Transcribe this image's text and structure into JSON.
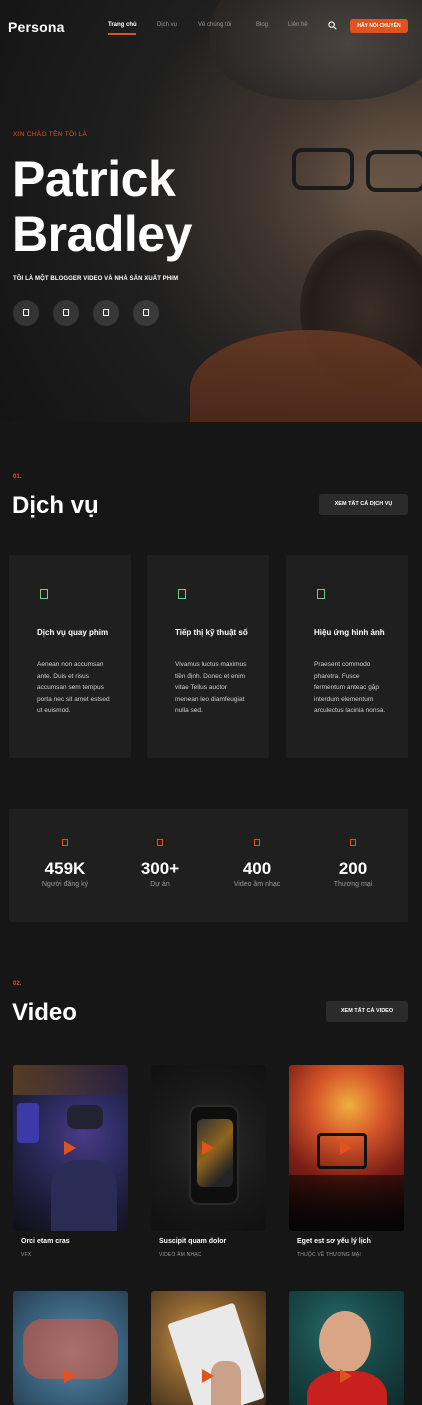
{
  "nav": {
    "logo": "Persona",
    "items": [
      "Trang chủ",
      "Dịch vụ",
      "Về chúng tôi",
      "Blog",
      "Liên hệ"
    ],
    "cta": "HÃY NÓI CHUYỆN"
  },
  "hero": {
    "eyebrow": "XIN CHÀO TÊN TÔI LÀ",
    "name_line1": "Patrick",
    "name_line2": "Bradley",
    "subtitle": "TÔI LÀ MỘT BLOGGER VIDEO VÀ NHÀ SẢN XUẤT PHIM",
    "social_icons": [
      "facebook-icon",
      "twitter-icon",
      "instagram-icon",
      "youtube-icon"
    ]
  },
  "services": {
    "number": "01.",
    "title": "Dịch vụ",
    "button": "XEM TẤT CẢ DỊCH VỤ",
    "cards": [
      {
        "title": "Dịch vụ quay phim",
        "text": "Aenean non accumsan ante. Duis et risus accumsan sem tempus porta nec sit amet estsed ut euismod."
      },
      {
        "title": "Tiếp thị kỹ thuật số",
        "text": "Vivamus luctus maximus tiền định. Donec et enim vitae Tellus auctor menean leo diamfeugiat nulla sed."
      },
      {
        "title": "Hiệu ứng hình ảnh",
        "text": "Praesent commodo pharetra. Fusce fermentum anteac gặp interdum elementum arculectus lacinia nonsa."
      }
    ]
  },
  "stats": [
    {
      "value": "459K",
      "label": "Người đăng ký"
    },
    {
      "value": "300+",
      "label": "Dự án"
    },
    {
      "value": "400",
      "label": "Video âm nhạc"
    },
    {
      "value": "200",
      "label": "Thương mại"
    }
  ],
  "videos": {
    "number": "02.",
    "title": "Video",
    "button": "XEM TẤT CẢ VIDEO",
    "items": [
      {
        "title": "Orci etam cras",
        "category": "VFX"
      },
      {
        "title": "Suscipit quam dolor",
        "category": "VIDEO ÂM NHẠC"
      },
      {
        "title": "Eget est sơ yếu lý lịch",
        "category": "THUỘC VỀ THƯƠNG MẠI"
      }
    ]
  },
  "colors": {
    "accent": "#e0531f",
    "background": "#161616",
    "card": "#1f1f1f"
  }
}
